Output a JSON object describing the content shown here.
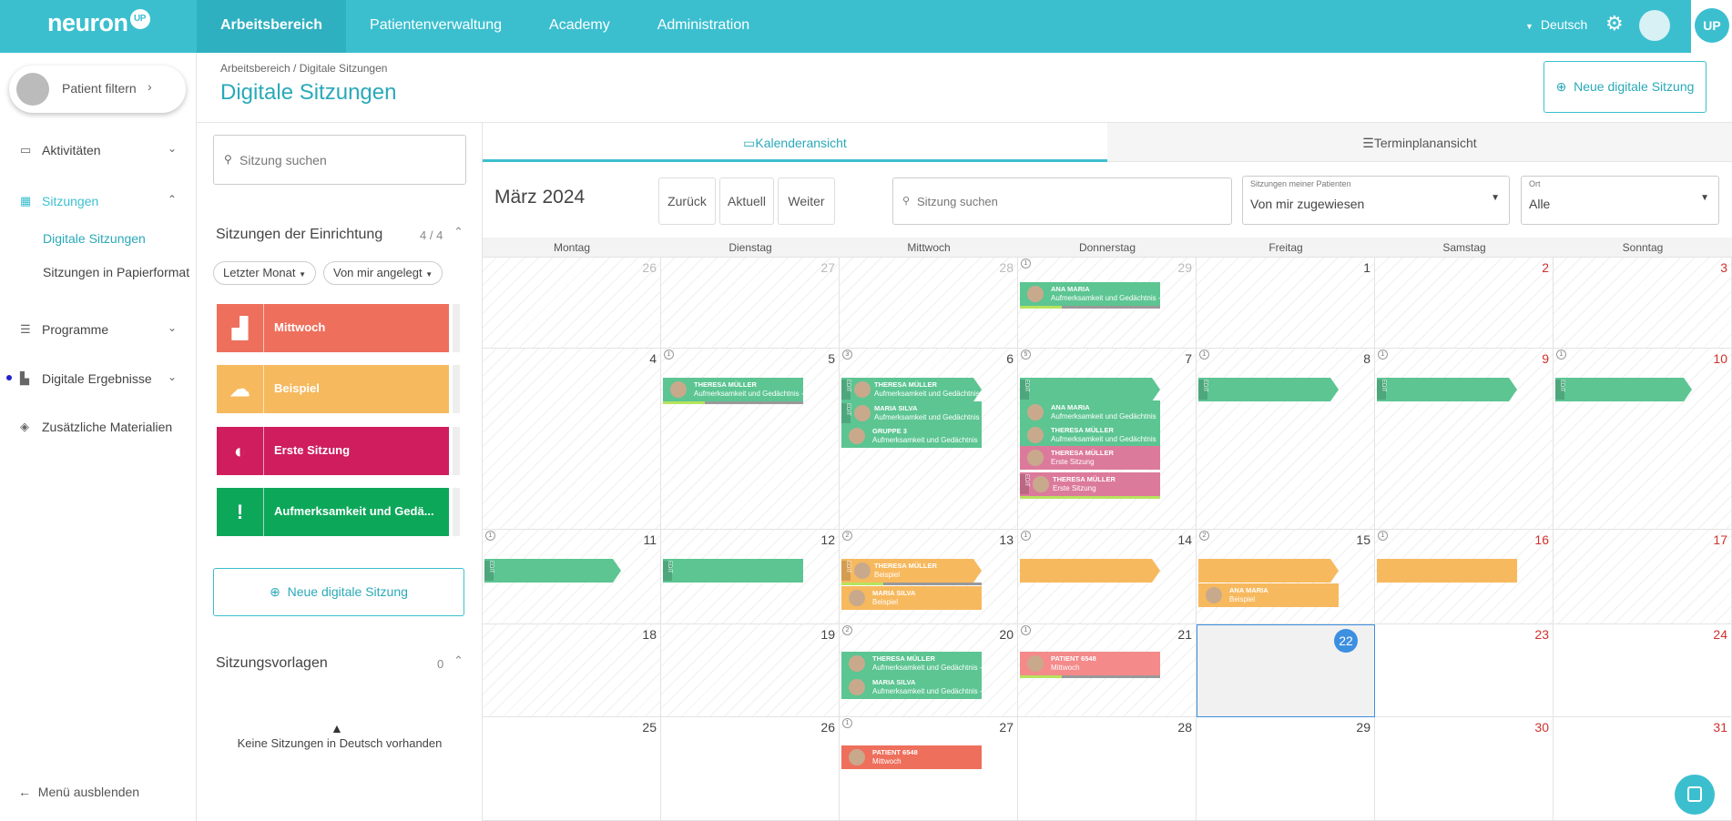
{
  "topbar": {
    "logo": "neuron",
    "logo_badge": "UP",
    "nav": [
      "Arbeitsbereich",
      "Patientenverwaltung",
      "Academy",
      "Administration"
    ],
    "language": "Deutsch",
    "brand_badge": "UP"
  },
  "sidebar": {
    "patient_filter": "Patient filtern",
    "items": [
      "Aktivitäten",
      "Sitzungen",
      "Programme",
      "Digitale Ergebnisse",
      "Zusätzliche Materialien"
    ],
    "sub_items": [
      "Digitale Sitzungen",
      "Sitzungen in Papierformat"
    ],
    "hide_menu": "Menü ausblenden"
  },
  "header": {
    "breadcrumb": "Arbeitsbereich  /  Digitale Sitzungen",
    "title": "Digitale Sitzungen",
    "new_button": "Neue digitale Sitzung"
  },
  "left_panel": {
    "search_placeholder": "Sitzung suchen",
    "section_title": "Sitzungen der Einrichtung",
    "section_count": "4 / 4",
    "filters": [
      "Letzter Monat",
      "Von mir angelegt"
    ],
    "sessions": [
      "Mittwoch",
      "Beispiel",
      "Erste Sitzung",
      "Aufmerksamkeit und Gedä..."
    ],
    "new_button": "Neue digitale Sitzung",
    "templates_title": "Sitzungsvorlagen",
    "templates_count": "0",
    "empty_text": "Keine Sitzungen in Deutsch vorhanden"
  },
  "calendar": {
    "tabs": [
      "Kalenderansicht",
      "Terminplanansicht"
    ],
    "month": "März 2024",
    "nav": [
      "Zurück",
      "Aktuell",
      "Weiter"
    ],
    "search_placeholder": "Sitzung suchen",
    "patients_select": {
      "label": "Sitzungen meiner Patienten",
      "value": "Von mir zugewiesen"
    },
    "place_select": {
      "label": "Ort",
      "value": "Alle"
    },
    "weekdays": [
      "Montag",
      "Dienstag",
      "Mittwoch",
      "Donnerstag",
      "Freitag",
      "Samstag",
      "Sonntag"
    ],
    "weeks": [
      [
        "26",
        "27",
        "28",
        "29",
        "1",
        "2",
        "3"
      ],
      [
        "4",
        "5",
        "6",
        "7",
        "8",
        "9",
        "10"
      ],
      [
        "11",
        "12",
        "13",
        "14",
        "15",
        "16",
        "17"
      ],
      [
        "18",
        "19",
        "20",
        "21",
        "22",
        "23",
        "24"
      ],
      [
        "25",
        "26",
        "27",
        "28",
        "29",
        "30",
        "31"
      ]
    ],
    "counts": {
      "w0d3": "1",
      "w1d1": "1",
      "w1d2": "3",
      "w1d3": "5",
      "w1d4": "1",
      "w1d5": "1",
      "w1d6": "1",
      "w2d0": "1",
      "w2d2": "2",
      "w2d3": "1",
      "w2d4": "2",
      "w2d5": "1",
      "w3d2": "2",
      "w3d3": "1",
      "w4d2": "1"
    },
    "today": "22",
    "events": [
      {
        "name": "ANA MARIA",
        "session": "Aufmerksamkeit und Gedächtnis - Frau"
      },
      {
        "name": "THERESA MÜLLER",
        "session": "Aufmerksamkeit und Gedächtnis - Frau"
      },
      {
        "name": "THERESA MÜLLER",
        "session": "Aufmerksamkeit und Gedächtnis"
      },
      {
        "name": "MARIA SILVA",
        "session": "Aufmerksamkeit und Gedächtnis"
      },
      {
        "name": "GRUPPE 3",
        "session": "Aufmerksamkeit und Gedächtnis"
      },
      {
        "name": "ANA MARIA",
        "session": "Aufmerksamkeit und Gedächtnis"
      },
      {
        "name": "THERESA MÜLLER",
        "session": "Aufmerksamkeit und Gedächtnis"
      },
      {
        "name": "THERESA MÜLLER",
        "session": "Erste Sitzung"
      },
      {
        "name": "THERESA MÜLLER",
        "session": "Erste Sitzung"
      },
      {
        "name": "THERESA MÜLLER",
        "session": "Beispiel"
      },
      {
        "name": "MARIA SILVA",
        "session": "Beispiel"
      },
      {
        "name": "ANA MARIA",
        "session": "Beispiel"
      },
      {
        "name": "THERESA MÜLLER",
        "session": "Aufmerksamkeit und Gedächtnis - Frau"
      },
      {
        "name": "MARIA SILVA",
        "session": "Aufmerksamkeit und Gedächtnis - Frau"
      },
      {
        "name": "PATIENT 6548",
        "session": "Mittwoch"
      },
      {
        "name": "PATIENT 6548",
        "session": "Mittwoch"
      }
    ],
    "edit_label": "EDIT"
  },
  "colors": {
    "brand": "#3bbfcf",
    "green": "#5cc592",
    "orange": "#f7b95e",
    "pink": "#dc7a9c",
    "red": "#ee6f5c",
    "today": "#3d8fe0"
  }
}
